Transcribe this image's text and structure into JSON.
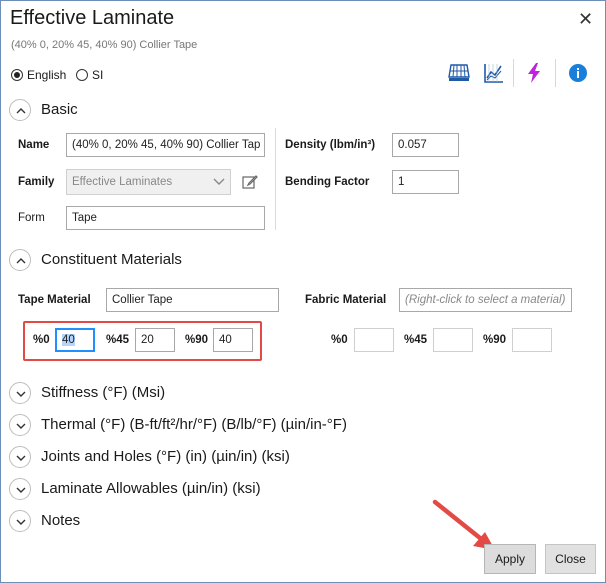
{
  "window": {
    "title": "Effective Laminate",
    "subtitle": "(40% 0, 20% 45, 40% 90) Collier Tape"
  },
  "units": {
    "english_label": "English",
    "si_label": "SI",
    "selected": "English"
  },
  "toolbar": {
    "icons": [
      "laminate-icon",
      "chart-icon",
      "lightning-icon",
      "info-icon"
    ],
    "colors": {
      "lightning": "#c023e0",
      "info": "#1a7fd8",
      "chart": "#1f5aa6"
    }
  },
  "basic": {
    "title": "Basic",
    "name_label": "Name",
    "name_value": "(40% 0, 20% 45, 40% 90) Collier Tap",
    "family_label": "Family",
    "family_value": "Effective Laminates",
    "form_label": "Form",
    "form_value": "Tape",
    "density_label": "Density (lbm/in³)",
    "density_value": "0.057",
    "bending_label": "Bending Factor",
    "bending_value": "1"
  },
  "constituent": {
    "title": "Constituent Materials",
    "tape_label": "Tape Material",
    "tape_value": "Collier Tape",
    "fabric_label": "Fabric Material",
    "fabric_placeholder": "(Right-click to select a material)",
    "tape_pct": [
      {
        "label": "%0",
        "value": "40"
      },
      {
        "label": "%45",
        "value": "20"
      },
      {
        "label": "%90",
        "value": "40"
      }
    ],
    "fabric_pct": [
      {
        "label": "%0",
        "value": ""
      },
      {
        "label": "%45",
        "value": ""
      },
      {
        "label": "%90",
        "value": ""
      }
    ]
  },
  "sections": {
    "stiffness": "Stiffness (°F) (Msi)",
    "thermal": "Thermal (°F) (B-ft/ft²/hr/°F) (B/lb/°F) (µin/in-°F)",
    "joints": "Joints and Holes (°F) (in) (µin/in) (ksi)",
    "allowables": "Laminate Allowables (µin/in) (ksi)",
    "notes": "Notes"
  },
  "buttons": {
    "apply": "Apply",
    "close": "Close"
  },
  "annotation_color": "#e34a46"
}
